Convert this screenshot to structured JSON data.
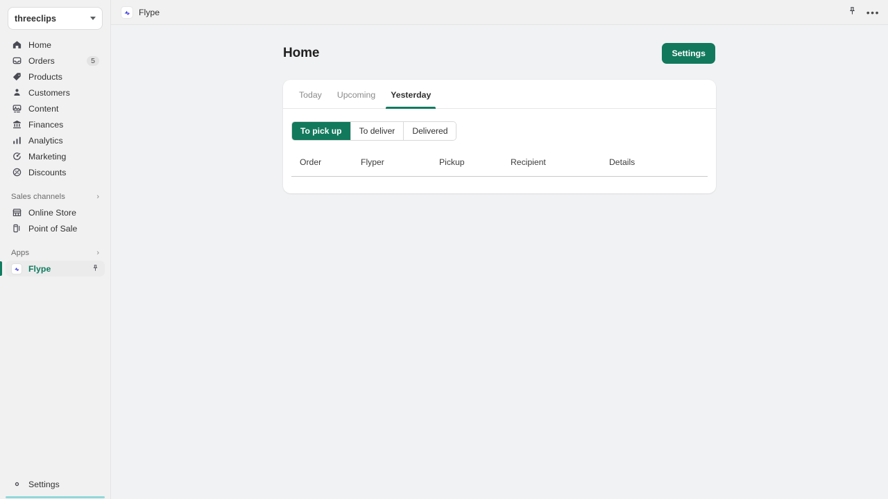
{
  "sidebar": {
    "store": {
      "name": "threeclips",
      "caret_icon": "chevron-down-icon"
    },
    "items": [
      {
        "label": "Home",
        "icon": "home-icon",
        "badge": null
      },
      {
        "label": "Orders",
        "icon": "inbox-icon",
        "badge": "5"
      },
      {
        "label": "Products",
        "icon": "tag-icon",
        "badge": null
      },
      {
        "label": "Customers",
        "icon": "person-icon",
        "badge": null
      },
      {
        "label": "Content",
        "icon": "image-icon",
        "badge": null
      },
      {
        "label": "Finances",
        "icon": "bank-icon",
        "badge": null
      },
      {
        "label": "Analytics",
        "icon": "bar-chart-icon",
        "badge": null
      },
      {
        "label": "Marketing",
        "icon": "megaphone-icon",
        "badge": null
      },
      {
        "label": "Discounts",
        "icon": "discount-icon",
        "badge": null
      }
    ],
    "sales_channels": {
      "title": "Sales channels",
      "chevron_icon": "chevron-right-icon",
      "items": [
        {
          "label": "Online Store",
          "icon": "storefront-icon"
        },
        {
          "label": "Point of Sale",
          "icon": "pos-icon"
        }
      ]
    },
    "apps": {
      "title": "Apps",
      "chevron_icon": "chevron-right-icon",
      "items": [
        {
          "label": "Flype",
          "icon": "flype-app-icon",
          "pin_icon": "pin-icon",
          "active": true
        }
      ]
    },
    "settings": {
      "label": "Settings",
      "icon": "gear-icon"
    }
  },
  "topbar": {
    "app_tab": {
      "label": "Flype",
      "icon": "flype-app-icon"
    },
    "pin_icon": "pin-icon",
    "more_icon": "more-horizontal-icon",
    "more_label": "•••"
  },
  "page": {
    "title": "Home",
    "settings_button": "Settings"
  },
  "card": {
    "tabs": [
      {
        "label": "Today",
        "active": false
      },
      {
        "label": "Upcoming",
        "active": false
      },
      {
        "label": "Yesterday",
        "active": true
      }
    ],
    "segments": [
      {
        "label": "To pick up",
        "active": true
      },
      {
        "label": "To deliver",
        "active": false
      },
      {
        "label": "Delivered",
        "active": false
      }
    ],
    "table": {
      "columns": [
        "Order",
        "Flyper",
        "Pickup",
        "Recipient",
        "Details"
      ],
      "rows": []
    }
  },
  "colors": {
    "brand_green": "#12795c",
    "accent_green": "#0f7b5f",
    "sidebar_bg": "#f1f1f1",
    "canvas_bg": "#f1f2f4",
    "loading_teal": "#92d7d9"
  }
}
